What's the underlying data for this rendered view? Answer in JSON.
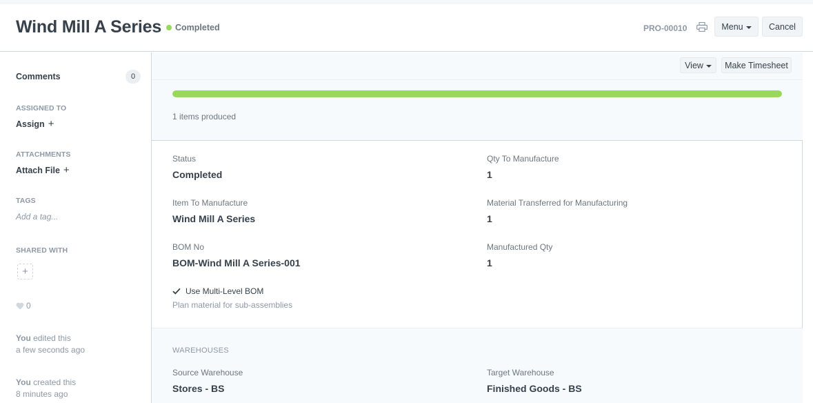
{
  "header": {
    "title": "Wind Mill A Series",
    "status": "Completed",
    "status_color": "#98d85b",
    "doc_name": "PRO-00010",
    "menu_label": "Menu",
    "cancel_label": "Cancel",
    "print_icon": "printer-icon"
  },
  "sidebar": {
    "comments_label": "Comments",
    "comments_count": "0",
    "assigned_to_label": "ASSIGNED TO",
    "assign_label": "Assign",
    "attachments_label": "ATTACHMENTS",
    "attach_label": "Attach File",
    "tags_label": "TAGS",
    "tag_placeholder": "Add a tag...",
    "shared_with_label": "SHARED WITH",
    "likes_count": "0",
    "activity": [
      {
        "actor": "You",
        "action": " edited this",
        "time": "a few seconds ago"
      },
      {
        "actor": "You",
        "action": " created this",
        "time": "8 minutes ago"
      }
    ]
  },
  "toolbar": {
    "view_label": "View",
    "timesheet_label": "Make Timesheet"
  },
  "progress": {
    "percent": 100,
    "note": "1 items produced",
    "color": "#98d85b"
  },
  "fields": {
    "status_label": "Status",
    "status_value": "Completed",
    "qty_label": "Qty To Manufacture",
    "qty_value": "1",
    "item_label": "Item To Manufacture",
    "item_value": "Wind Mill A Series",
    "transferred_label": "Material Transferred for Manufacturing",
    "transferred_value": "1",
    "bom_label": "BOM No",
    "bom_value": "BOM-Wind Mill A Series-001",
    "manufactured_label": "Manufactured Qty",
    "manufactured_value": "1",
    "multilevel_label": "Use Multi-Level BOM",
    "multilevel_checked": true,
    "multilevel_desc": "Plan material for sub-assemblies"
  },
  "warehouses": {
    "section_label": "WAREHOUSES",
    "source_label": "Source Warehouse",
    "source_value": "Stores - BS",
    "target_label": "Target Warehouse",
    "target_value": "Finished Goods - BS"
  }
}
